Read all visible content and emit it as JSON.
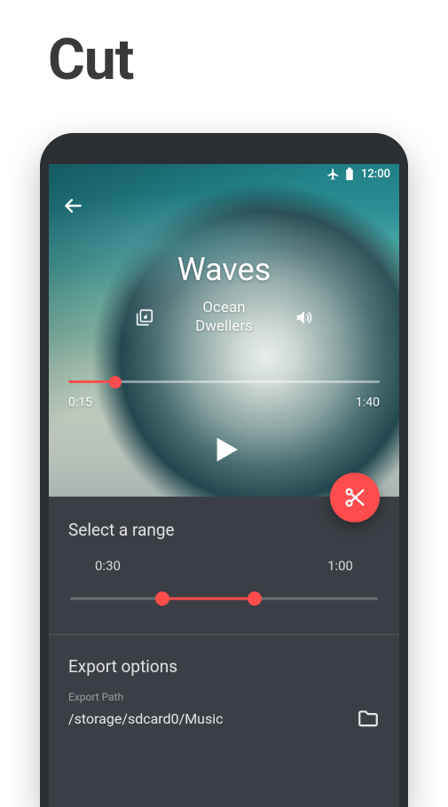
{
  "page": {
    "title": "Cut"
  },
  "status_bar": {
    "time": "12:00"
  },
  "player": {
    "track_title": "Waves",
    "artist": "Ocean\nDwellers",
    "elapsed": "0:15",
    "duration": "1:40",
    "progress_pct": 15
  },
  "range": {
    "heading": "Select a range",
    "start": "0:30",
    "end": "1:00",
    "start_pct": 30,
    "end_pct": 60
  },
  "export": {
    "heading": "Export options",
    "path_label": "Export Path",
    "path_value": "/storage/sdcard0/Music"
  },
  "colors": {
    "accent": "#ff4d4d",
    "panel": "#3b3f45"
  }
}
